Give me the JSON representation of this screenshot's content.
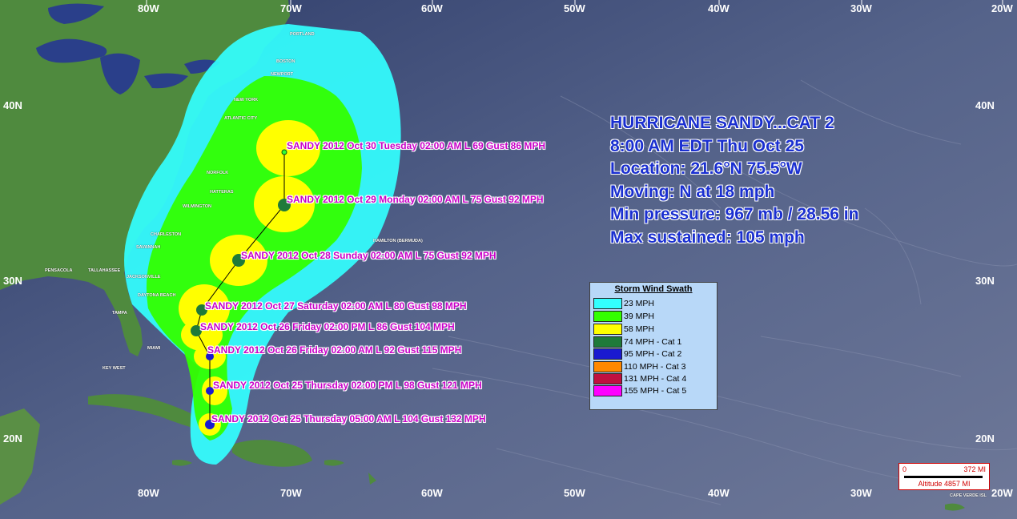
{
  "grid": {
    "lon_top": [
      "80W",
      "70W",
      "60W",
      "50W",
      "40W",
      "30W",
      "20W"
    ],
    "lon_bottom": [
      "80W",
      "70W",
      "60W",
      "50W",
      "40W",
      "30W",
      "20W"
    ],
    "lat_left": [
      "40N",
      "30N",
      "20N"
    ],
    "lat_right": [
      "40N",
      "30N",
      "20N"
    ]
  },
  "info": {
    "title": "HURRICANE SANDY...CAT 2",
    "time": "8:00 AM EDT Thu Oct 25",
    "location": "Location: 21.6°N 75.5°W",
    "moving": "Moving: N at 18 mph",
    "pressure": "Min pressure: 967 mb / 28.56 in",
    "sustained": "Max sustained: 105 mph"
  },
  "storm_points": [
    {
      "label": "SANDY 2012 Oct 30 Tuesday 02:00 AM L 69 Gust 86 MPH"
    },
    {
      "label": "SANDY 2012 Oct 29 Monday 02:00 AM L 75 Gust 92 MPH"
    },
    {
      "label": "SANDY 2012 Oct 28 Sunday 02:00 AM L 75 Gust 92 MPH"
    },
    {
      "label": "SANDY 2012 Oct 27 Saturday 02:00 AM L 80 Gust 98 MPH"
    },
    {
      "label": "SANDY 2012 Oct 26 Friday 02:00 PM L 86 Gust 104 MPH"
    },
    {
      "label": "SANDY 2012 Oct 26 Friday 02:00 AM L 92 Gust 115 MPH"
    },
    {
      "label": "SANDY 2012 Oct 25 Thursday 02:00 PM L 98 Gust 121 MPH"
    },
    {
      "label": "SANDY 2012 Oct 25 Thursday 05:00 AM L 104 Gust 132 MPH"
    }
  ],
  "legend": {
    "title": "Storm Wind Swath",
    "items": [
      {
        "label": "23 MPH",
        "color": "#33ffff"
      },
      {
        "label": "39 MPH",
        "color": "#33ff00"
      },
      {
        "label": "58 MPH",
        "color": "#ffff00"
      },
      {
        "label": "74 MPH - Cat 1",
        "color": "#1f7a3a"
      },
      {
        "label": "95 MPH - Cat 2",
        "color": "#1a1ad0"
      },
      {
        "label": "110 MPH - Cat 3",
        "color": "#ff8800"
      },
      {
        "label": "131 MPH - Cat 4",
        "color": "#c01040"
      },
      {
        "label": "155 MPH - Cat 5",
        "color": "#ff00ff"
      }
    ]
  },
  "scale": {
    "zero": "0",
    "end": "372 MI",
    "altitude": "Altitude 4857 MI"
  },
  "cities": [
    "PORTLAND",
    "BOSTON",
    "NEWPORT",
    "NEW YORK",
    "ATLANTIC CITY",
    "NORFOLK",
    "HATTERAS",
    "WILMINGTON",
    "CHARLESTON",
    "SAVANNAH",
    "JACKSONVILLE",
    "DAYTONA BEACH",
    "MIAMI",
    "KEY WEST",
    "TAMPA",
    "PENSACOLA",
    "TALLAHASSEE",
    "HAMILTON (BERMUDA)",
    "CAPE VERDE ISL"
  ]
}
